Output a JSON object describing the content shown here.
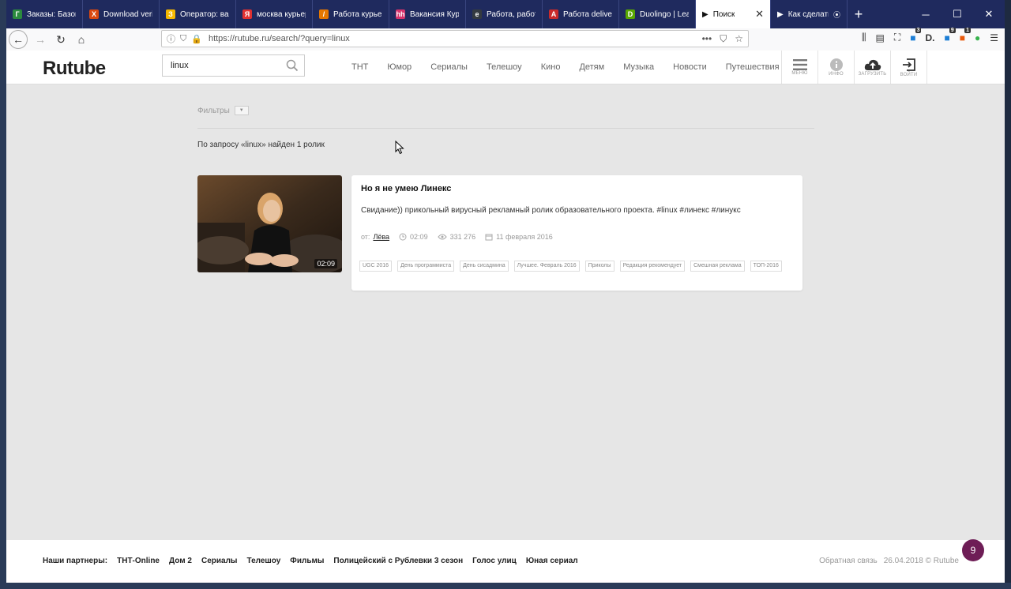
{
  "browser": {
    "tabs": [
      {
        "title": "Заказы: Базовы",
        "fav_color": "#2b8a3e",
        "fav_text": "Г"
      },
      {
        "title": "Download verif",
        "fav_color": "#d9480f",
        "fav_text": "X"
      },
      {
        "title": "Оператор: вак",
        "fav_color": "#f5b800",
        "fav_text": "З"
      },
      {
        "title": "москва курьер",
        "fav_color": "#e03131",
        "fav_text": "Я"
      },
      {
        "title": "Работа курьер",
        "fav_color": "#e67700",
        "fav_text": "/"
      },
      {
        "title": "Вакансия Курь",
        "fav_color": "#d6336c",
        "fav_text": "hh"
      },
      {
        "title": "Работа, работа",
        "fav_color": "#343a40",
        "fav_text": "e"
      },
      {
        "title": "Работа delivery",
        "fav_color": "#c92a2a",
        "fav_text": "A"
      },
      {
        "title": "Duolingo | Lear",
        "fav_color": "#58a700",
        "fav_text": "D"
      }
    ],
    "active_tab": {
      "title": "Поиск",
      "close": "✕"
    },
    "last_tab": {
      "title": "Как сделать"
    },
    "url": "https://rutube.ru/search/?query=linux",
    "badges": {
      "b1": "3",
      "b2": "9",
      "b3": "1"
    }
  },
  "site": {
    "logo": "Rutube",
    "search_value": "linux",
    "nav": [
      "ТНТ",
      "Юмор",
      "Сериалы",
      "Телешоу",
      "Кино",
      "Детям",
      "Музыка",
      "Новости",
      "Путешествия"
    ],
    "header_buttons": {
      "menu": "МЕНЮ",
      "info": "ИНФО",
      "upload": "ЗАГРУЗИТЬ",
      "login": "ВОЙТИ"
    }
  },
  "filters_label": "Фильтры",
  "result_count": "По запросу «linux» найден 1 ролик",
  "video": {
    "duration": "02:09",
    "title": "Но я не умею Линекс",
    "description": "Свидание)) прикольный вирусный рекламный ролик образовательного проекта. #linux #линекс #линукс",
    "author_prefix": "от:",
    "author": "Лёва",
    "length": "02:09",
    "views": "331 276",
    "date": "11 февраля 2016",
    "tags": [
      "UGC 2016",
      "День программиста",
      "День сисадмина",
      "Лучшее. Февраль 2016",
      "Приколы",
      "Редакция рекомендует",
      "Смешная реклама",
      "ТОП-2016"
    ]
  },
  "footer": {
    "partners_label": "Наши партнеры:",
    "partners": [
      "ТНТ-Online",
      "Дом 2",
      "Сериалы",
      "Телешоу",
      "Фильмы",
      "Полицейский с Рублевки 3 сезон",
      "Голос улиц",
      "Юная сериал"
    ],
    "feedback": "Обратная связь",
    "date": "26.04.2018 © Rutube"
  },
  "chat_badge": "9"
}
